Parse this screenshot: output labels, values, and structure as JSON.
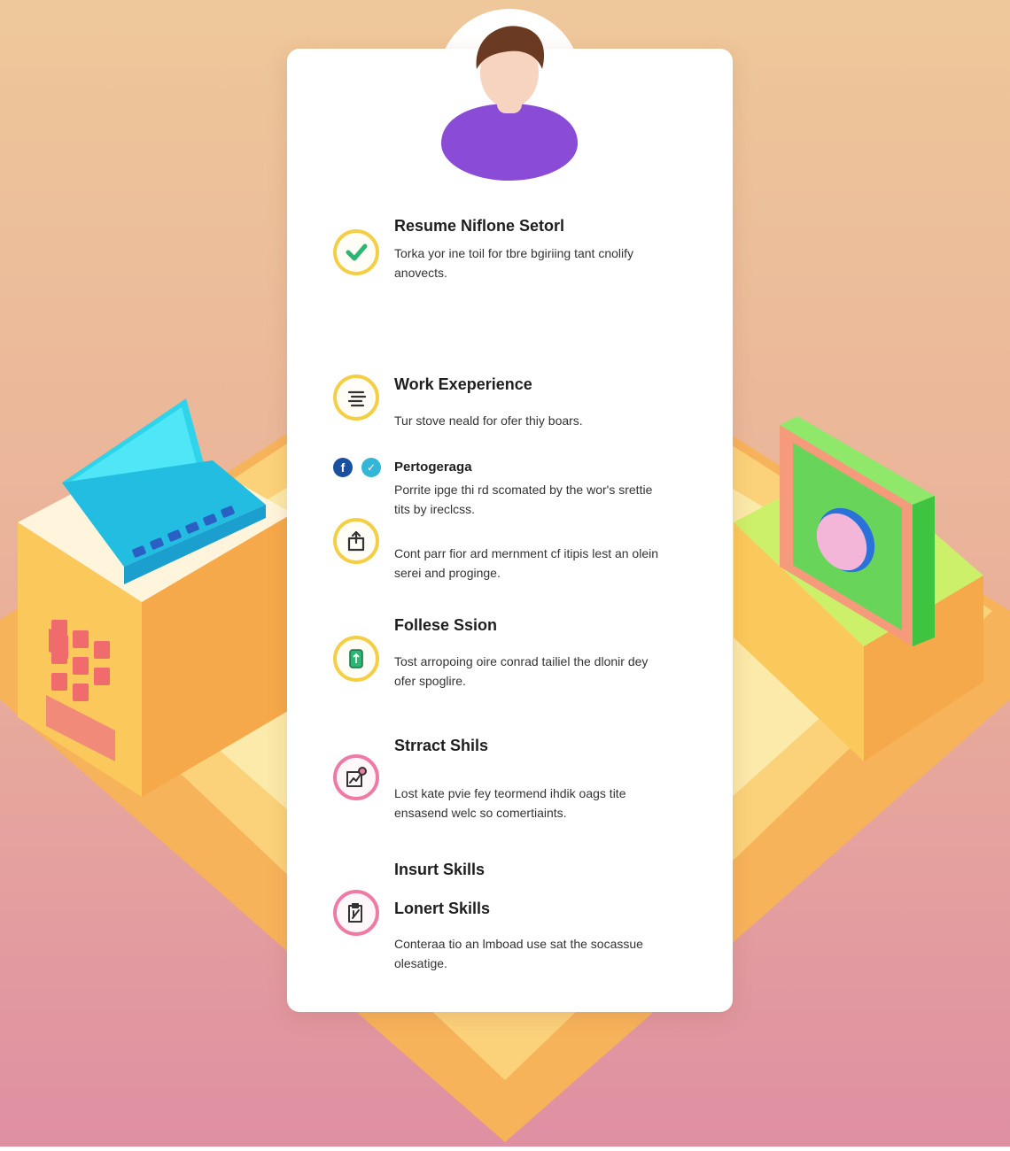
{
  "colors": {
    "background_top": "#eec89a",
    "background_bottom": "#df8fa2",
    "card": "#ffffff",
    "ring_yellow": "#f4cf45",
    "ring_pink": "#ef7aa6",
    "check_green": "#2bb673",
    "avatar_shirt": "#8a4bd6",
    "avatar_hair": "#6b3a22",
    "facebook_blue": "#1b4fa0",
    "twitter_teal": "#34b7d6"
  },
  "sections": [
    {
      "title": "Resume Niflone Setorl",
      "text": "Torka yor ine toil for tbre bgiriing tant cnolify anovects.",
      "icon": "check-icon"
    },
    {
      "title": "Work Exeperience",
      "text": "Tur stove neald for ofer thiy boars.",
      "icon": "document-icon"
    },
    {
      "title": "Pertogeraga",
      "text": "Porrite ipge thi rd scomated by the wor's srettie tits by ireclcss.",
      "icons": [
        "facebook-icon",
        "twitter-icon"
      ]
    },
    {
      "title": "",
      "text": "Cont parr fior ard mernment cf itipis lest an olein serei and proginge.",
      "icon": "share-icon"
    },
    {
      "title": "Follese Ssion",
      "text": "Tost arropoing oire conrad tailiel the dlonir dey ofer spoglire.",
      "icon": "device-icon"
    },
    {
      "title": "Strract Shils",
      "text": "Lost kate pvie fey teormend ihdik oags tite ensasend welc so comertiaints.",
      "icon": "chart-icon"
    },
    {
      "title": "Insurt Skills",
      "text": "",
      "icon": ""
    },
    {
      "title": "Lonert Skills",
      "text": "Conteraa tio an lmboad use sat the socassue olesatige.",
      "icon": "clipboard-icon"
    }
  ]
}
